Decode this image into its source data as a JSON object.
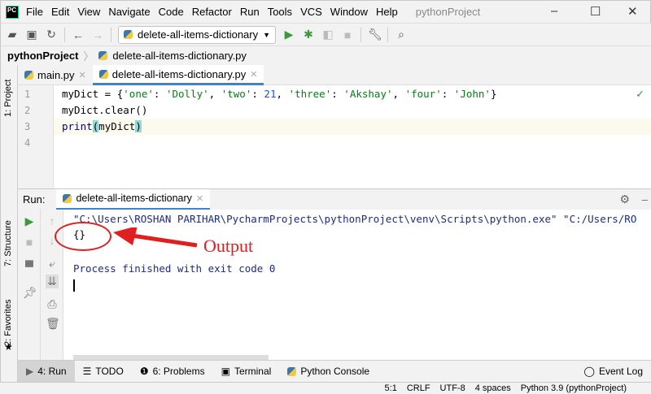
{
  "menubar": {
    "logo": "PC",
    "items": [
      "File",
      "Edit",
      "View",
      "Navigate",
      "Code",
      "Refactor",
      "Run",
      "Tools",
      "VCS",
      "Window",
      "Help"
    ],
    "title": "pythonProject"
  },
  "toolbar": {
    "run_config": "delete-all-items-dictionary"
  },
  "breadcrumb": {
    "project": "pythonProject",
    "file": "delete-all-items-dictionary.py"
  },
  "side_labels": {
    "project": "1: Project",
    "structure": "7: Structure",
    "favorites": "2: Favorites"
  },
  "tabs": [
    {
      "label": "main.py"
    },
    {
      "label": "delete-all-items-dictionary.py"
    }
  ],
  "editor": {
    "line_numbers": [
      "1",
      "2",
      "3",
      "4"
    ],
    "line1": {
      "a": "myDict = {",
      "s1": "'one'",
      "b": ": ",
      "s2": "'Dolly'",
      "c": ", ",
      "s3": "'two'",
      "d": ": ",
      "n1": "21",
      "e": ", ",
      "s4": "'three'",
      "f": ": ",
      "s5": "'Akshay'",
      "g": ", ",
      "s6": "'four'",
      "h": ": ",
      "s7": "'John'",
      "i": "}"
    },
    "line2": "myDict.clear()",
    "line3": {
      "fn": "print",
      "open": "(",
      "arg": "myDict",
      "close": ")"
    }
  },
  "run": {
    "label": "Run:",
    "tab": "delete-all-items-dictionary",
    "console": [
      "\"C:\\Users\\ROSHAN PARIHAR\\PycharmProjects\\pythonProject\\venv\\Scripts\\python.exe\" \"C:/Users/RO",
      "{}",
      "",
      "Process finished with exit code 0"
    ],
    "annotation": "Output"
  },
  "bottom_tabs": [
    "4: Run",
    "TODO",
    "6: Problems",
    "Terminal",
    "Python Console"
  ],
  "event_log": "Event Log",
  "status": [
    "5:1",
    "CRLF",
    "UTF-8",
    "4 spaces",
    "Python 3.9 (pythonProject)"
  ]
}
